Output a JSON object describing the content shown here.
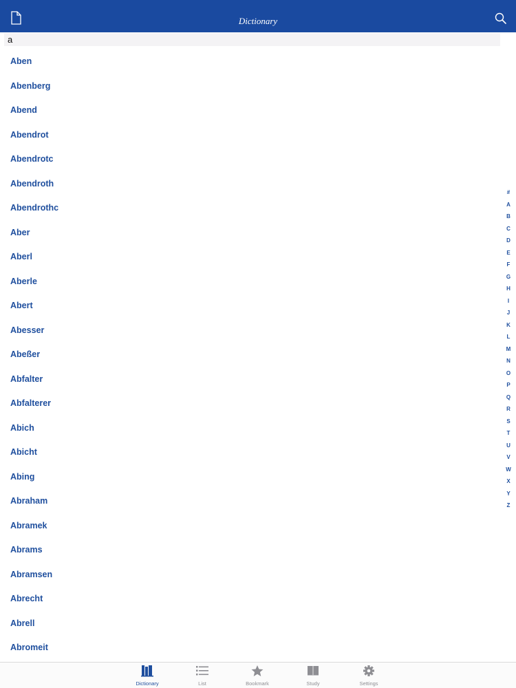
{
  "navbar": {
    "title": "Dictionary",
    "left_icon": "document-icon",
    "right_icon": "search-icon",
    "background": "#1a4aa0"
  },
  "search": {
    "value": "a"
  },
  "words": [
    "Aben",
    "Abenberg",
    "Abend",
    "Abendrot",
    "Abendrotc",
    "Abendroth",
    "Abendrothc",
    "Aber",
    "Aberl",
    "Aberle",
    "Abert",
    "Abesser",
    "Abeßer",
    "Abfalter",
    "Abfalterer",
    "Abich",
    "Abicht",
    "Abing",
    "Abraham",
    "Abramek",
    "Abrams",
    "Abramsen",
    "Abrecht",
    "Abrell",
    "Abromeit"
  ],
  "index_letters": [
    "#",
    "A",
    "B",
    "C",
    "D",
    "E",
    "F",
    "G",
    "H",
    "I",
    "J",
    "K",
    "L",
    "M",
    "N",
    "O",
    "P",
    "Q",
    "R",
    "S",
    "T",
    "U",
    "V",
    "W",
    "X",
    "Y",
    "Z"
  ],
  "tabs": [
    {
      "label": "Dictionary",
      "icon": "books-icon",
      "active": true
    },
    {
      "label": "List",
      "icon": "list-icon",
      "active": false
    },
    {
      "label": "Bookmark",
      "icon": "star-icon",
      "active": false
    },
    {
      "label": "Study",
      "icon": "open-book-icon",
      "active": false
    },
    {
      "label": "Settings",
      "icon": "gear-icon",
      "active": false
    }
  ],
  "colors": {
    "accent": "#1f4f9e",
    "inactive_tab": "#8e8e93"
  }
}
